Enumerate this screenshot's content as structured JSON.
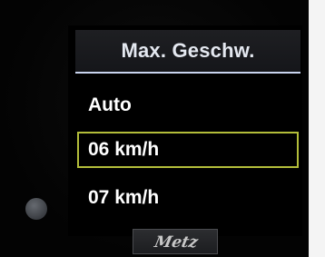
{
  "menu": {
    "title": "Max. Geschw.",
    "items": [
      {
        "label": "Auto",
        "selected": false
      },
      {
        "label": "06 km/h",
        "selected": true
      },
      {
        "label": "07 km/h",
        "selected": false
      }
    ]
  },
  "brand": {
    "logo_text": "Metz"
  },
  "colors": {
    "highlight_border": "#b3bd3a",
    "title_underline": "#c9d4ee",
    "text": "#ffffff"
  },
  "icons": {
    "side_button": "round-button-icon",
    "logo": "metz-logo-icon"
  }
}
